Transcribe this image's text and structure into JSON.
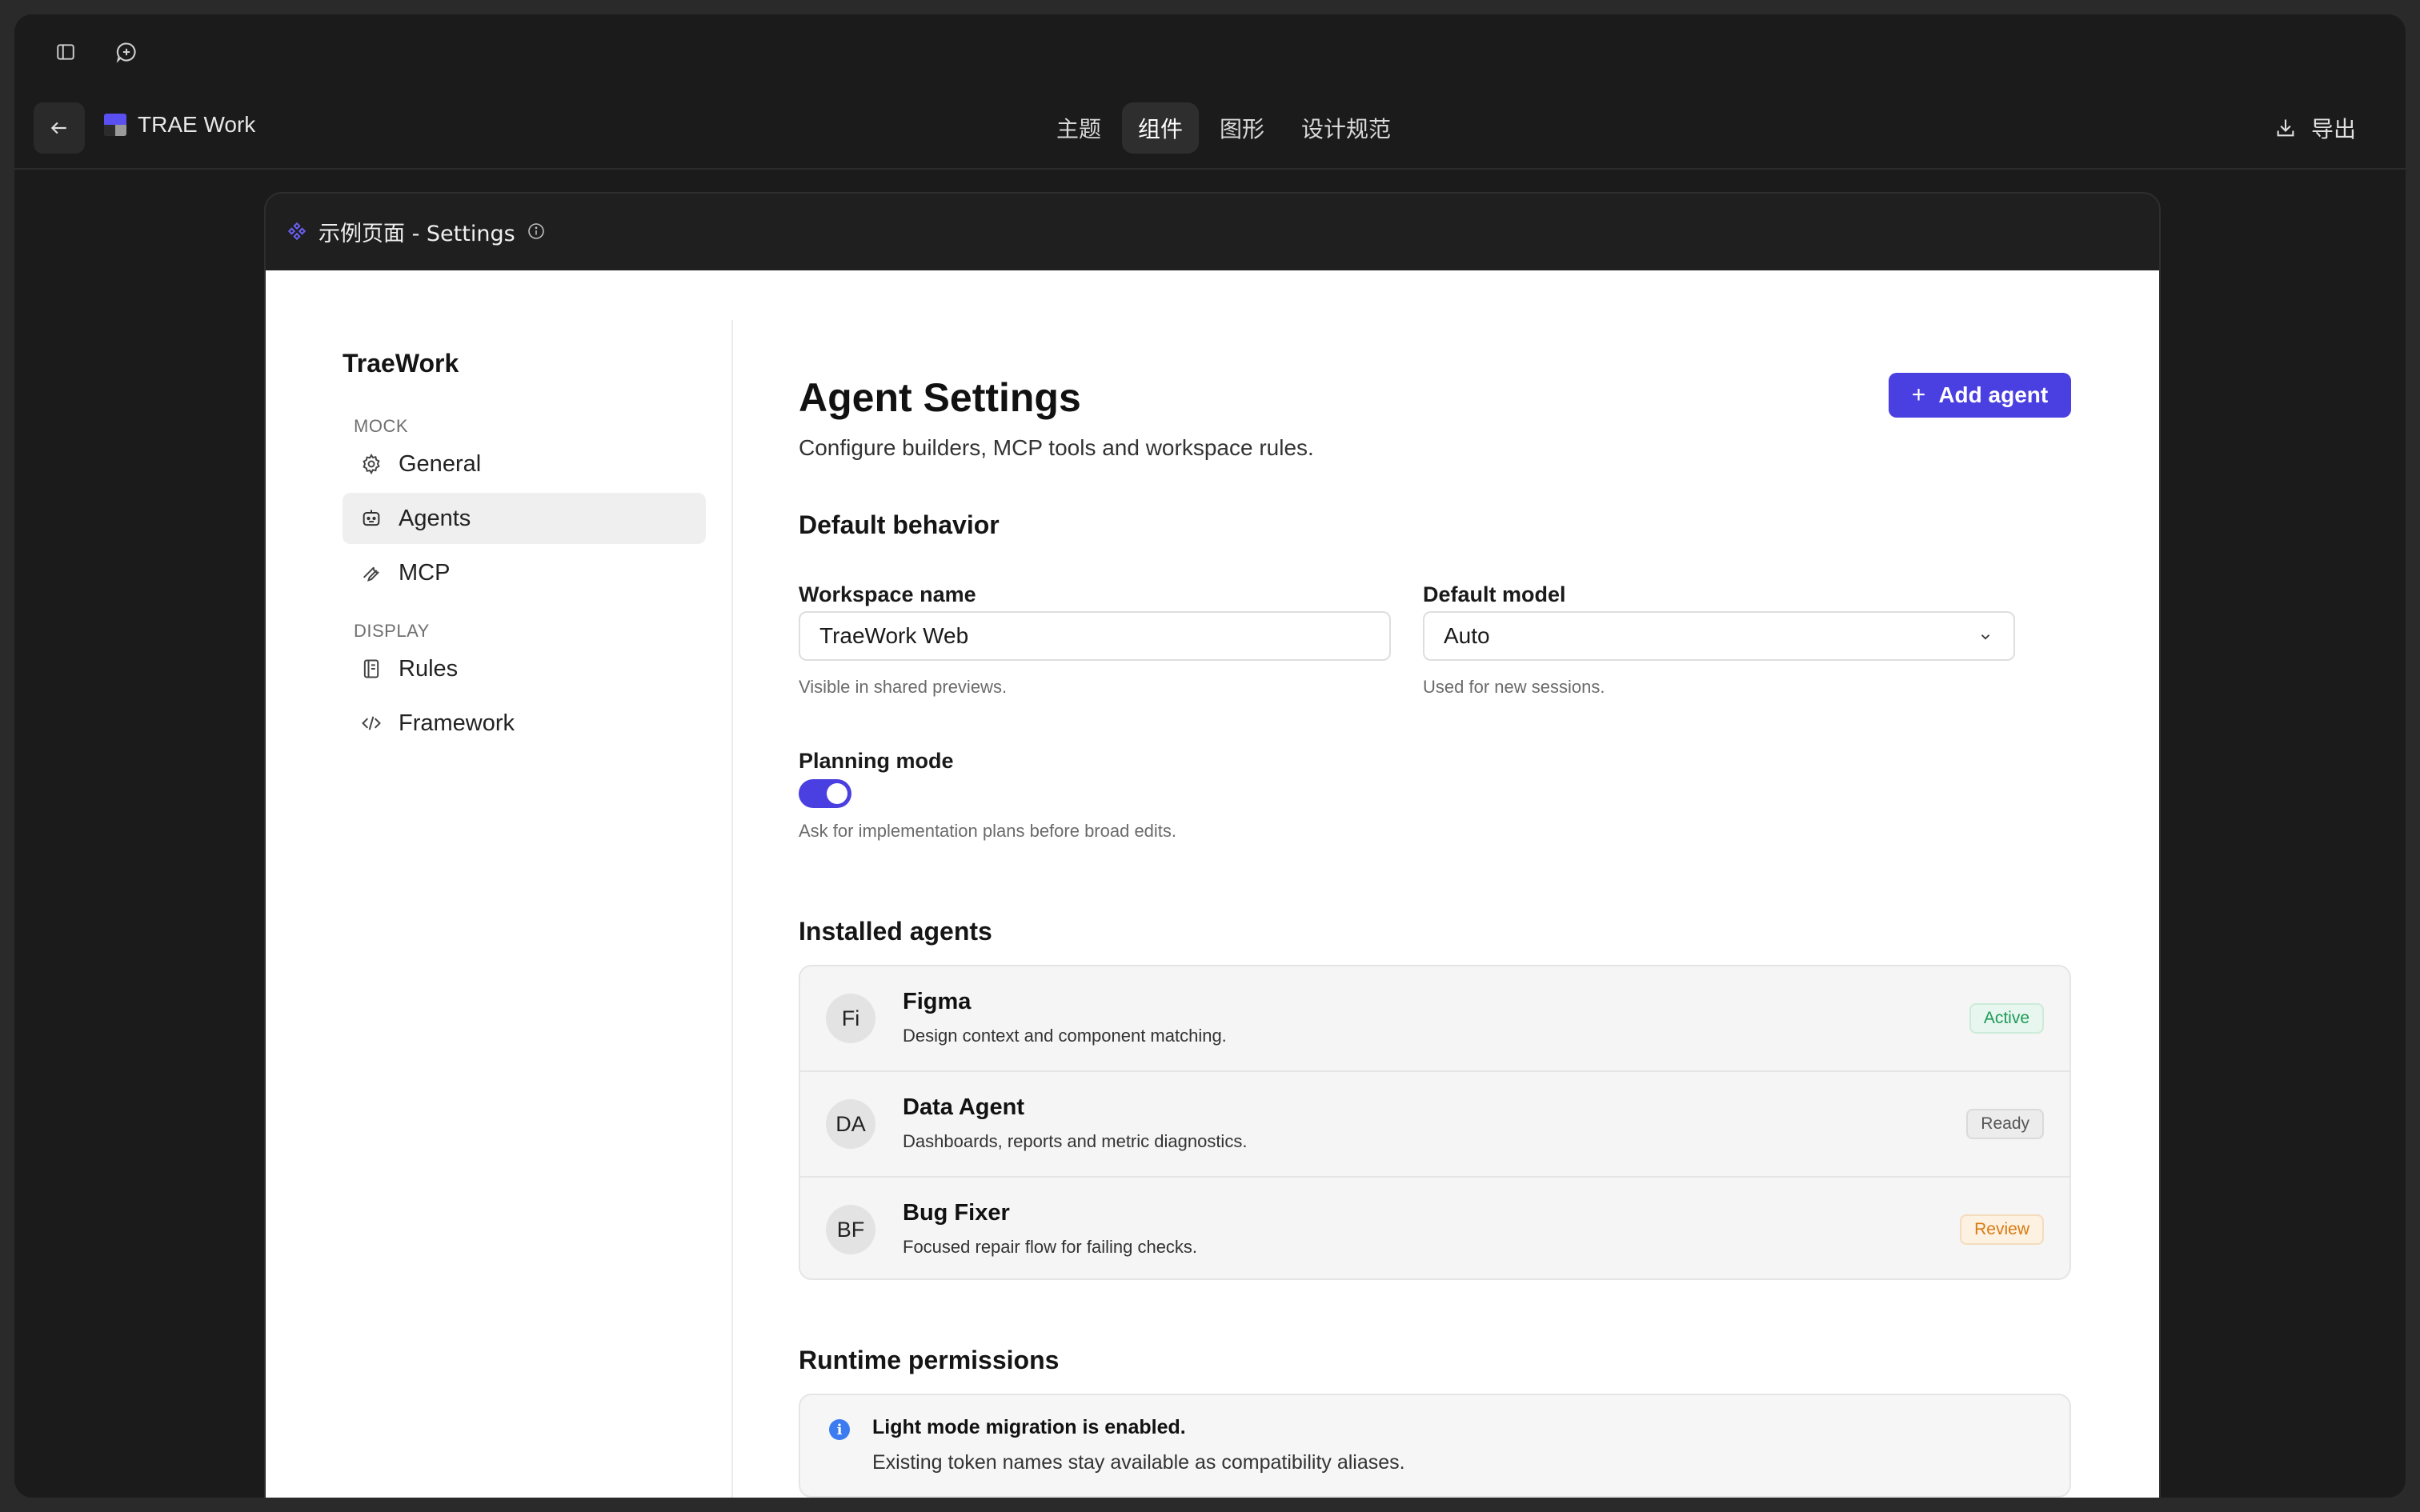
{
  "topbar": {
    "brand": "TRAE Work",
    "tabs": [
      "主题",
      "组件",
      "图形",
      "设计规范"
    ],
    "active_tab": "组件",
    "export_label": "导出"
  },
  "frame": {
    "title": "示例页面 - Settings"
  },
  "sidebar": {
    "title": "TraeWork",
    "sections": [
      {
        "label": "MOCK",
        "items": [
          "General",
          "Agents",
          "MCP"
        ]
      },
      {
        "label": "DISPLAY",
        "items": [
          "Rules",
          "Framework"
        ]
      }
    ],
    "active_item": "Agents"
  },
  "page": {
    "title": "Agent Settings",
    "subtitle": "Configure builders, MCP tools and workspace rules.",
    "add_button": "Add agent"
  },
  "default_behavior": {
    "heading": "Default behavior",
    "workspace_label": "Workspace name",
    "workspace_value": "TraeWork Web",
    "workspace_hint": "Visible in shared previews.",
    "model_label": "Default model",
    "model_value": "Auto",
    "model_hint": "Used for new sessions.",
    "planning_label": "Planning mode",
    "planning_enabled": true,
    "planning_hint": "Ask for implementation plans before broad edits."
  },
  "installed_agents": {
    "heading": "Installed agents",
    "items": [
      {
        "initials": "Fi",
        "name": "Figma",
        "desc": "Design context and component matching.",
        "status": "Active"
      },
      {
        "initials": "DA",
        "name": "Data Agent",
        "desc": "Dashboards, reports and metric diagnostics.",
        "status": "Ready"
      },
      {
        "initials": "BF",
        "name": "Bug Fixer",
        "desc": "Focused repair flow for failing checks.",
        "status": "Review"
      }
    ]
  },
  "runtime": {
    "heading": "Runtime permissions",
    "alert_title": "Light mode migration is enabled.",
    "alert_text": "Existing token names stay available as compatibility aliases."
  },
  "colors": {
    "accent": "#4a3fe0",
    "active_badge": "#1e9a5a",
    "review_badge": "#d97a12",
    "info": "#3d7cf0"
  }
}
